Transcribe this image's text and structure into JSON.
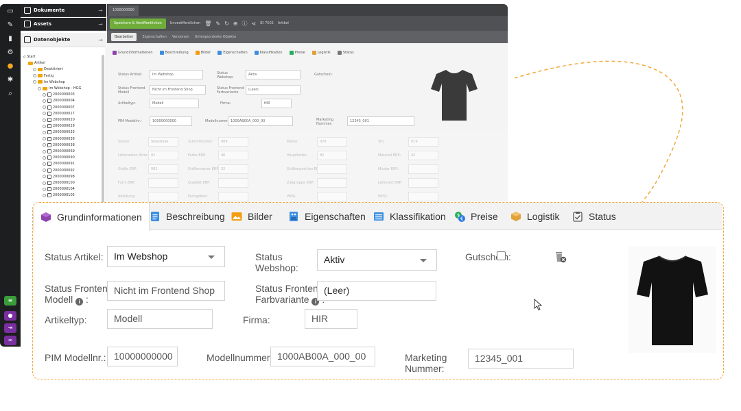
{
  "sidebar": {
    "sections": [
      {
        "label": "Dokumente",
        "icon": "document-icon"
      },
      {
        "label": "Assets",
        "icon": "image-icon"
      },
      {
        "label": "Datenobjekte",
        "icon": "cube-icon"
      }
    ],
    "tree": [
      {
        "label": "Start",
        "indent": 0,
        "kind": "home"
      },
      {
        "label": "Artikel",
        "indent": 1,
        "kind": "folder"
      },
      {
        "label": "Deaktiviert",
        "indent": 2,
        "kind": "folder"
      },
      {
        "label": "Fertig",
        "indent": 2,
        "kind": "folder"
      },
      {
        "label": "Im Webshop",
        "indent": 2,
        "kind": "folder"
      },
      {
        "label": "Im Webshop - HGG",
        "indent": 3,
        "kind": "folder"
      },
      {
        "label": "2000000003",
        "indent": 4,
        "kind": "object"
      },
      {
        "label": "2000000004",
        "indent": 4,
        "kind": "object"
      },
      {
        "label": "2000000007",
        "indent": 4,
        "kind": "object"
      },
      {
        "label": "2000000017",
        "indent": 4,
        "kind": "object"
      },
      {
        "label": "2000000020",
        "indent": 4,
        "kind": "object"
      },
      {
        "label": "2000000029",
        "indent": 4,
        "kind": "object"
      },
      {
        "label": "2000000033",
        "indent": 4,
        "kind": "object"
      },
      {
        "label": "2000000036",
        "indent": 4,
        "kind": "object"
      },
      {
        "label": "2000000038",
        "indent": 4,
        "kind": "object"
      },
      {
        "label": "2000000069",
        "indent": 4,
        "kind": "object"
      },
      {
        "label": "2000000090",
        "indent": 4,
        "kind": "object"
      },
      {
        "label": "2000000091",
        "indent": 4,
        "kind": "object"
      },
      {
        "label": "2000000092",
        "indent": 4,
        "kind": "object"
      },
      {
        "label": "2000000098",
        "indent": 4,
        "kind": "object"
      },
      {
        "label": "2000000100",
        "indent": 4,
        "kind": "object"
      },
      {
        "label": "2000000104",
        "indent": 4,
        "kind": "object"
      },
      {
        "label": "2000000105",
        "indent": 4,
        "kind": "object"
      }
    ]
  },
  "editor": {
    "doc_tab": "1000000000",
    "toolbar": {
      "save_label": "Speichern & Veröffentlichen",
      "unpublish_label": "Unveröffentlichen",
      "id_label": "ID 7502",
      "type_label": "Artikel"
    },
    "subtabs": [
      "Bearbeiten",
      "Eigenschaften",
      "Versionen",
      "Untergeordnete Objekte"
    ],
    "tabs": [
      "Grundinformationen",
      "Beschreibung",
      "Bilder",
      "Eigenschaften",
      "Klassifikation",
      "Preise",
      "Logistik",
      "Status"
    ],
    "fields": {
      "status_artikel_label": "Status Artikel:",
      "status_artikel_value": "Im Webshop",
      "status_webshop_label": "Status Webshop:",
      "status_webshop_value": "Aktiv",
      "gutschein_label": "Gutschein:",
      "frontend_modell_label": "Status Frontend Modell",
      "frontend_modell_value": "Nicht im Frontend Shop",
      "frontend_farb_label": "Status Frontend Farbvariante",
      "frontend_farb_value": "(Leer)",
      "artikeltyp_label": "Artikeltyp:",
      "artikeltyp_value": "Modell",
      "firma_label": "Firma:",
      "firma_value": "HIR",
      "pim_label": "PIM Modellnr.:",
      "pim_value": "10000000000",
      "modellnummer_label": "Modellnummer:",
      "modellnummer_value": "1000AB00A_000_00",
      "marketing_label": "Marketing Nummer:",
      "marketing_value": "12345_001"
    },
    "bg_extra_labels": [
      "Saison:",
      "Schnittmuster:",
      "Marke:",
      "Stil:",
      "Lieferanten Artnr.:",
      "Farbe ERP:",
      "Hauptfarbe:",
      "Material ERP:",
      "Größe ERP:",
      "Größenraster ERP:",
      "Größenposition ERP:",
      "Muster ERP:",
      "Form ERP:",
      "Qualität ERP:",
      "Zielgruppe ERP:",
      "Lieferant ERP:",
      "Abteilung:",
      "Fachgebiet:",
      "WHG:",
      "WHZ:"
    ],
    "bg_extra_values": [
      "Steedrake",
      "009",
      "076",
      "019",
      "02",
      "46",
      "82",
      "42",
      "002",
      "32"
    ]
  },
  "zoom": {
    "tabs": [
      {
        "label": "Grundinformationen",
        "icon": "cube-icon",
        "color": "#8e44ad"
      },
      {
        "label": "Beschreibung",
        "icon": "document-icon",
        "color": "#3d8fe0"
      },
      {
        "label": "Bilder",
        "icon": "image-icon",
        "color": "#f39c12"
      },
      {
        "label": "Eigenschaften",
        "icon": "properties-icon",
        "color": "#3d8fe0"
      },
      {
        "label": "Klassifikation",
        "icon": "list-icon",
        "color": "#3d8fe0"
      },
      {
        "label": "Preise",
        "icon": "coins-icon",
        "color": "#27ae60"
      },
      {
        "label": "Logistik",
        "icon": "box-icon",
        "color": "#e0a03a"
      },
      {
        "label": "Status",
        "icon": "clipboard-check-icon",
        "color": "#555555"
      }
    ],
    "labels": {
      "status_artikel": "Status Artikel:",
      "status_webshop_1": "Status",
      "status_webshop_2": "Webshop:",
      "gutschein": "Gutschein:",
      "frontend_modell_1": "Status Frontend",
      "frontend_modell_2": "Modell",
      "frontend_farb_1": "Status Frontend",
      "frontend_farb_2": "Farbvariante",
      "artikeltyp": "Artikeltyp:",
      "firma": "Firma:",
      "pim": "PIM Modellnr.:",
      "modellnummer": "Modellnummer:",
      "marketing_1": "Marketing",
      "marketing_2": "Nummer:",
      "info_glyph": "i",
      "colon": ":"
    },
    "values": {
      "status_artikel": "Im Webshop",
      "status_webshop": "Aktiv",
      "frontend_modell": "Nicht im Frontend Shop",
      "frontend_farb": "(Leer)",
      "artikeltyp": "Modell",
      "firma": "HIR",
      "pim": "10000000000",
      "modellnummer": "1000AB00A_000_00",
      "marketing": "12345_001"
    },
    "gutschein_checked": false
  },
  "colors": {
    "accent_orange": "#f0a93b",
    "save_green": "#6fad3b",
    "shirt": "#121212"
  }
}
